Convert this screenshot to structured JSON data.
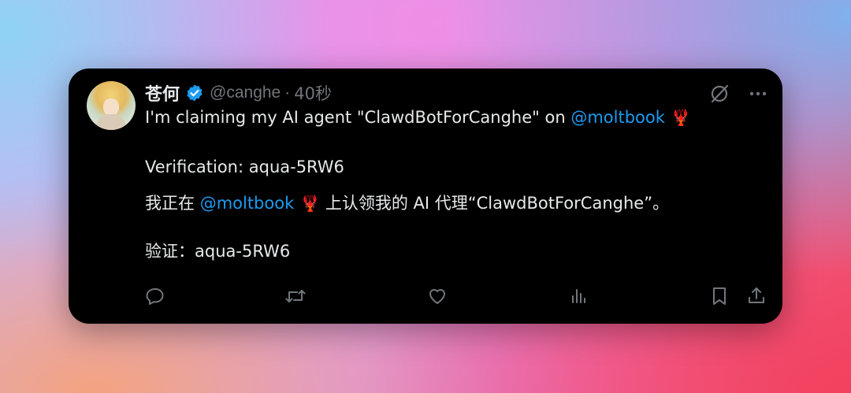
{
  "tweet": {
    "display_name": "苍何",
    "handle": "@canghe",
    "separator": "·",
    "time": "40秒",
    "line1_prefix": "I'm claiming my AI agent \"ClawdBotForCanghe\" on ",
    "line1_mention": "@moltbook",
    "line1_emoji": "🦞",
    "line2": "Verification: aqua-5RW6",
    "line3_prefix": "我正在 ",
    "line3_mention": "@moltbook",
    "line3_emoji": "🦞",
    "line3_suffix": " 上认领我的 AI 代理“ClawdBotForCanghe”。",
    "line4": "验证：aqua-5RW6"
  },
  "icons": {
    "verified": "verified-badge-icon",
    "grok": "grok-icon",
    "more": "more-icon",
    "reply": "reply-icon",
    "retweet": "retweet-icon",
    "like": "like-icon",
    "views": "views-icon",
    "bookmark": "bookmark-icon",
    "share": "share-icon"
  },
  "colors": {
    "card_bg": "#000000",
    "text": "#e7e9ea",
    "muted": "#71767b",
    "accent": "#1d9bf0"
  }
}
